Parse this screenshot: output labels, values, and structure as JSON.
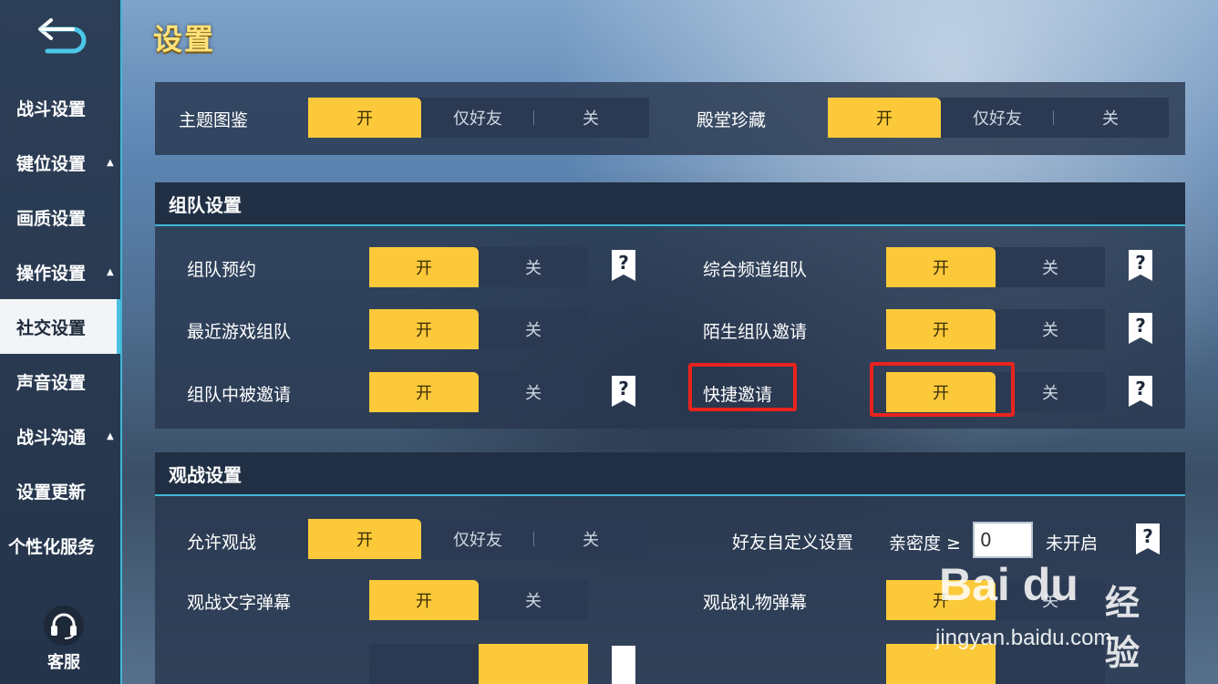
{
  "page": {
    "title": "设置"
  },
  "sidebar": {
    "items": [
      {
        "label": "战斗设置"
      },
      {
        "label": "键位设置",
        "arrow": "▲"
      },
      {
        "label": "画质设置"
      },
      {
        "label": "操作设置",
        "arrow": "▲"
      },
      {
        "label": "社交设置",
        "active": true
      },
      {
        "label": "声音设置"
      },
      {
        "label": "战斗沟通",
        "arrow": "▲"
      },
      {
        "label": "设置更新"
      },
      {
        "label": "个性化服务"
      }
    ],
    "service_label": "客服"
  },
  "top": {
    "theme": {
      "label": "主题图鉴",
      "options": [
        "开",
        "仅好友",
        "关"
      ],
      "selected": "开"
    },
    "hall": {
      "label": "殿堂珍藏",
      "options": [
        "开",
        "仅好友",
        "关"
      ],
      "selected": "开"
    }
  },
  "team": {
    "header": "组队设置",
    "on": "开",
    "off": "关",
    "rows": [
      {
        "label": "组队预约"
      },
      {
        "label": "综合频道组队"
      },
      {
        "label": "最近游戏组队"
      },
      {
        "label": "陌生组队邀请"
      },
      {
        "label": "组队中被邀请"
      },
      {
        "label": "快捷邀请"
      }
    ]
  },
  "watch": {
    "header": "观战设置",
    "allow": {
      "label": "允许观战",
      "options": [
        "开",
        "仅好友",
        "关"
      ],
      "selected": "开"
    },
    "friend": {
      "label": "好友自定义设置",
      "intimacy": "亲密度 ≥",
      "value": "0",
      "status": "未开启"
    },
    "danmu": {
      "label": "观战文字弹幕",
      "on": "开",
      "off": "关"
    },
    "gift": {
      "label": "观战礼物弹幕",
      "on": "开",
      "off": "关"
    }
  },
  "help_symbol": "?",
  "watermark": {
    "logo": "Bai du",
    "text": "经验",
    "url": "jingyan.baidu.com"
  },
  "colors": {
    "accent": "#fcc93a",
    "highlight": "#e8231d",
    "divider": "#3fb7d4"
  }
}
